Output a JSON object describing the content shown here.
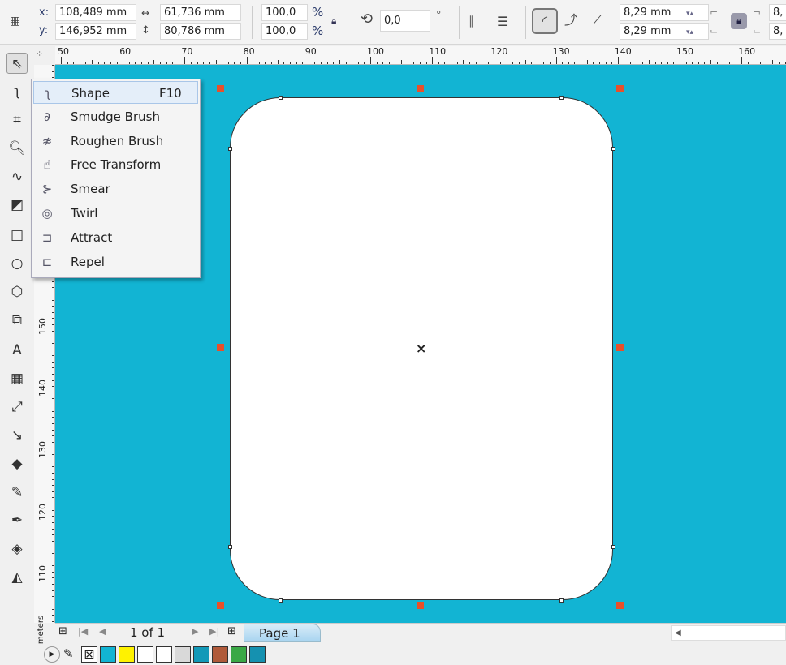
{
  "propertybar": {
    "x_label": "x:",
    "x_value": "108,489 mm",
    "y_label": "y:",
    "y_value": "146,952 mm",
    "width_value": "61,736 mm",
    "height_value": "80,786 mm",
    "scale_x": "100,0",
    "scale_y": "100,0",
    "percent": "%",
    "rotation": "0,0",
    "degree": "°",
    "corner_radius_top": "8,29 mm",
    "corner_radius_bottom": "8,29 mm",
    "corner_radius_right_top": "8,",
    "corner_radius_right_bottom": "8,"
  },
  "ruler": {
    "h_ticks": [
      "50",
      "60",
      "70",
      "80",
      "90",
      "100",
      "110",
      "120",
      "130",
      "140",
      "150",
      "160"
    ],
    "v_ticks": [
      "150",
      "140",
      "130",
      "120",
      "110"
    ],
    "unit": "millimeters"
  },
  "flyout": {
    "items": [
      {
        "label": "Shape",
        "shortcut": "F10",
        "icon": "shape-tool-icon"
      },
      {
        "label": "Smudge Brush",
        "icon": "smudge-brush-icon"
      },
      {
        "label": "Roughen Brush",
        "icon": "roughen-brush-icon"
      },
      {
        "label": "Free Transform",
        "icon": "free-transform-icon"
      },
      {
        "label": "Smear",
        "icon": "smear-icon"
      },
      {
        "label": "Twirl",
        "icon": "twirl-icon"
      },
      {
        "label": "Attract",
        "icon": "attract-icon"
      },
      {
        "label": "Repel",
        "icon": "repel-icon"
      }
    ]
  },
  "pagebar": {
    "page_count": "1 of 1",
    "page_tab": "Page 1"
  },
  "palette": {
    "colors": [
      "#12b4d3",
      "#fff200",
      "#ffffff",
      "#ffffff",
      "#d9d9d9",
      "#1399b8",
      "#b05a3a",
      "#3aa846",
      "#1591b0"
    ]
  },
  "colors": {
    "canvas": "#12b4d3",
    "handle": "#e8502a"
  }
}
